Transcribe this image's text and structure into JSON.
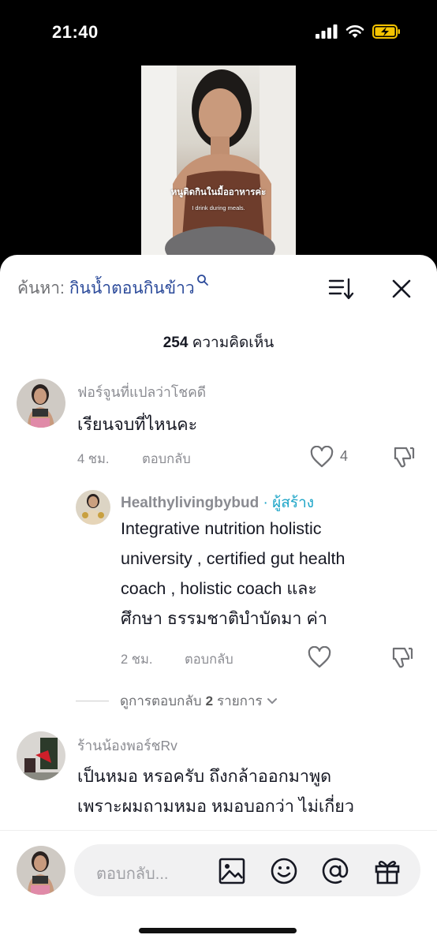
{
  "status": {
    "time": "21:40"
  },
  "video": {
    "subtitle_th": "หนูติดกินในมื้ออาหารค่ะ",
    "subtitle_en": "I drink during meals."
  },
  "header": {
    "search_prefix": "ค้นหา:",
    "search_term": "กินน้ำตอนกินข้าว",
    "comment_count": "254",
    "comment_count_label": "ความคิดเห็น"
  },
  "comments": [
    {
      "username": "ฟอร์จูนที่แปลว่าโชคดี",
      "text": "เรียนจบที่ไหนคะ",
      "time": "4 ชม.",
      "reply_label": "ตอบกลับ",
      "likes": "4"
    },
    {
      "username": "Healthylivingbybud",
      "creator_tag": "· ผู้สร้าง",
      "text_lines": [
        "Integrative nutrition holistic",
        "university , certified gut health",
        "coach , holistic coach และ",
        "ศึกษา ธรรมชาติบำบัดมา ค่า"
      ],
      "time": "2 ชม.",
      "reply_label": "ตอบกลับ"
    },
    {
      "username": "ร้านน้องพอร์ชRv",
      "text_lines": [
        "เป็นหมอ หรอครับ ถึงกล้าออกมาพูด",
        "เพราะผมถามหมอ หมอบอกว่า ไม่เกี่ยว"
      ]
    }
  ],
  "view_replies": {
    "prefix": "ดูการตอบกลับ",
    "count": "2",
    "suffix": "รายการ"
  },
  "input": {
    "placeholder": "ตอบกลับ..."
  },
  "colors": {
    "accent": "#2b4a9a",
    "creator": "#1ba4c7",
    "battery": "#f5c400"
  }
}
